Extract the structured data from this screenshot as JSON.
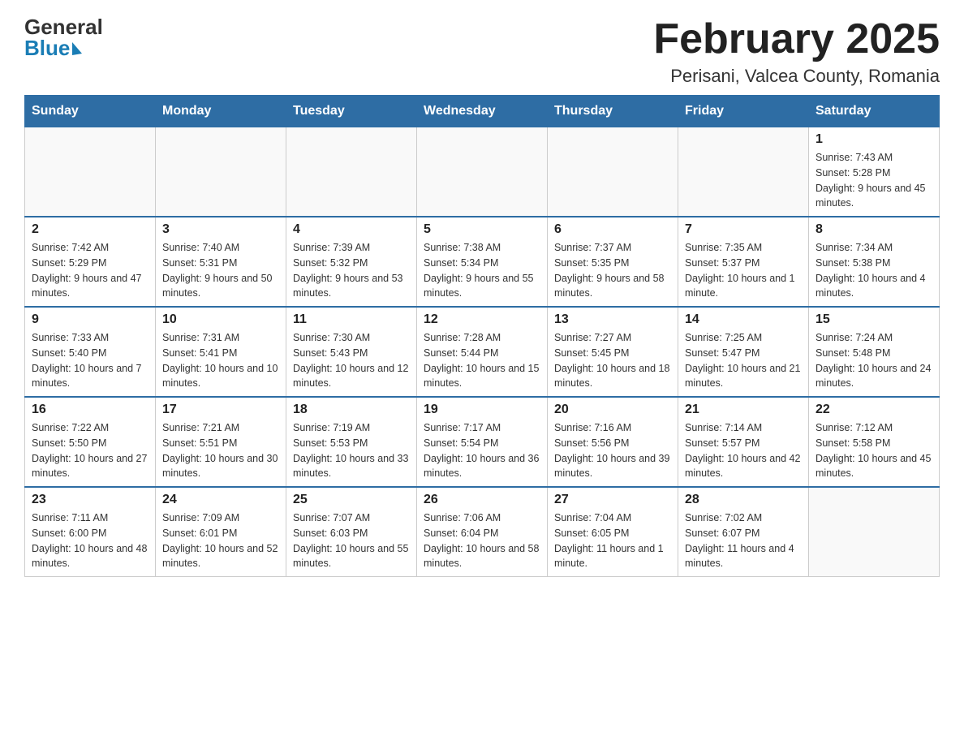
{
  "header": {
    "month_title": "February 2025",
    "location": "Perisani, Valcea County, Romania",
    "logo_top": "General",
    "logo_bottom": "Blue"
  },
  "weekdays": [
    "Sunday",
    "Monday",
    "Tuesday",
    "Wednesday",
    "Thursday",
    "Friday",
    "Saturday"
  ],
  "weeks": [
    [
      {
        "day": "",
        "info": ""
      },
      {
        "day": "",
        "info": ""
      },
      {
        "day": "",
        "info": ""
      },
      {
        "day": "",
        "info": ""
      },
      {
        "day": "",
        "info": ""
      },
      {
        "day": "",
        "info": ""
      },
      {
        "day": "1",
        "info": "Sunrise: 7:43 AM\nSunset: 5:28 PM\nDaylight: 9 hours and 45 minutes."
      }
    ],
    [
      {
        "day": "2",
        "info": "Sunrise: 7:42 AM\nSunset: 5:29 PM\nDaylight: 9 hours and 47 minutes."
      },
      {
        "day": "3",
        "info": "Sunrise: 7:40 AM\nSunset: 5:31 PM\nDaylight: 9 hours and 50 minutes."
      },
      {
        "day": "4",
        "info": "Sunrise: 7:39 AM\nSunset: 5:32 PM\nDaylight: 9 hours and 53 minutes."
      },
      {
        "day": "5",
        "info": "Sunrise: 7:38 AM\nSunset: 5:34 PM\nDaylight: 9 hours and 55 minutes."
      },
      {
        "day": "6",
        "info": "Sunrise: 7:37 AM\nSunset: 5:35 PM\nDaylight: 9 hours and 58 minutes."
      },
      {
        "day": "7",
        "info": "Sunrise: 7:35 AM\nSunset: 5:37 PM\nDaylight: 10 hours and 1 minute."
      },
      {
        "day": "8",
        "info": "Sunrise: 7:34 AM\nSunset: 5:38 PM\nDaylight: 10 hours and 4 minutes."
      }
    ],
    [
      {
        "day": "9",
        "info": "Sunrise: 7:33 AM\nSunset: 5:40 PM\nDaylight: 10 hours and 7 minutes."
      },
      {
        "day": "10",
        "info": "Sunrise: 7:31 AM\nSunset: 5:41 PM\nDaylight: 10 hours and 10 minutes."
      },
      {
        "day": "11",
        "info": "Sunrise: 7:30 AM\nSunset: 5:43 PM\nDaylight: 10 hours and 12 minutes."
      },
      {
        "day": "12",
        "info": "Sunrise: 7:28 AM\nSunset: 5:44 PM\nDaylight: 10 hours and 15 minutes."
      },
      {
        "day": "13",
        "info": "Sunrise: 7:27 AM\nSunset: 5:45 PM\nDaylight: 10 hours and 18 minutes."
      },
      {
        "day": "14",
        "info": "Sunrise: 7:25 AM\nSunset: 5:47 PM\nDaylight: 10 hours and 21 minutes."
      },
      {
        "day": "15",
        "info": "Sunrise: 7:24 AM\nSunset: 5:48 PM\nDaylight: 10 hours and 24 minutes."
      }
    ],
    [
      {
        "day": "16",
        "info": "Sunrise: 7:22 AM\nSunset: 5:50 PM\nDaylight: 10 hours and 27 minutes."
      },
      {
        "day": "17",
        "info": "Sunrise: 7:21 AM\nSunset: 5:51 PM\nDaylight: 10 hours and 30 minutes."
      },
      {
        "day": "18",
        "info": "Sunrise: 7:19 AM\nSunset: 5:53 PM\nDaylight: 10 hours and 33 minutes."
      },
      {
        "day": "19",
        "info": "Sunrise: 7:17 AM\nSunset: 5:54 PM\nDaylight: 10 hours and 36 minutes."
      },
      {
        "day": "20",
        "info": "Sunrise: 7:16 AM\nSunset: 5:56 PM\nDaylight: 10 hours and 39 minutes."
      },
      {
        "day": "21",
        "info": "Sunrise: 7:14 AM\nSunset: 5:57 PM\nDaylight: 10 hours and 42 minutes."
      },
      {
        "day": "22",
        "info": "Sunrise: 7:12 AM\nSunset: 5:58 PM\nDaylight: 10 hours and 45 minutes."
      }
    ],
    [
      {
        "day": "23",
        "info": "Sunrise: 7:11 AM\nSunset: 6:00 PM\nDaylight: 10 hours and 48 minutes."
      },
      {
        "day": "24",
        "info": "Sunrise: 7:09 AM\nSunset: 6:01 PM\nDaylight: 10 hours and 52 minutes."
      },
      {
        "day": "25",
        "info": "Sunrise: 7:07 AM\nSunset: 6:03 PM\nDaylight: 10 hours and 55 minutes."
      },
      {
        "day": "26",
        "info": "Sunrise: 7:06 AM\nSunset: 6:04 PM\nDaylight: 10 hours and 58 minutes."
      },
      {
        "day": "27",
        "info": "Sunrise: 7:04 AM\nSunset: 6:05 PM\nDaylight: 11 hours and 1 minute."
      },
      {
        "day": "28",
        "info": "Sunrise: 7:02 AM\nSunset: 6:07 PM\nDaylight: 11 hours and 4 minutes."
      },
      {
        "day": "",
        "info": ""
      }
    ]
  ]
}
